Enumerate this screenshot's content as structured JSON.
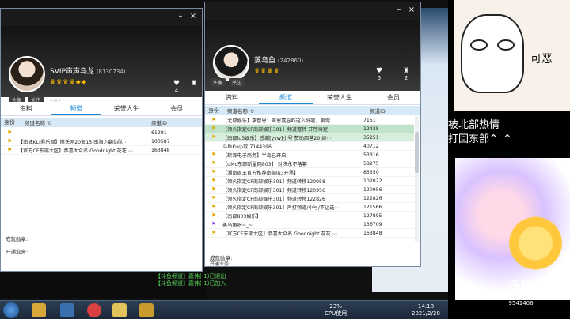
{
  "left_window": {
    "user": {
      "name": "SVIP声声乌龙",
      "id": "(8130734)",
      "sub": "vwy"
    },
    "mini_tabs": [
      "头像",
      "关注"
    ],
    "stats": [
      {
        "icon": "heart-icon",
        "value": "4"
      },
      {
        "icon": "trophy-icon",
        "value": ""
      }
    ],
    "tabs": [
      "资料",
      "频道",
      "荣誉人生",
      "会员"
    ],
    "headers": {
      "pos": "身份",
      "name": "频道名称",
      "id": "频道ID"
    },
    "rows": [
      {
        "name": "",
        "id": "61291"
      },
      {
        "name": "【南城KLI俱乐部】崩氏网20安15  南海之翻伪队⋯",
        "id": "100587"
      },
      {
        "name": "【官方CF东部大区】恭喜大众名 Goodnight 花花 ⋯",
        "id": "163848"
      }
    ],
    "footer": [
      "成就勋章:",
      "开通业务:"
    ]
  },
  "right_window": {
    "user": {
      "name": "蒸乌鱼",
      "id": "(242860)"
    },
    "mini_tabs": [
      "头像",
      "关注"
    ],
    "stats": [
      {
        "icon": "heart-icon",
        "value": "5"
      },
      {
        "icon": "trophy-icon",
        "value": "2"
      }
    ],
    "tabs": [
      "资料",
      "频道",
      "荣誉人生",
      "会员"
    ],
    "headers": {
      "pos": "身份",
      "name": "频道名称",
      "id": "频道ID"
    },
    "rows": [
      {
        "name": "【北部娱乐】李智恩：声恩嘉@咋这么好呢，爱你",
        "id": "7151"
      },
      {
        "name": "【领久指定CF南部娱乐301】频道整转 开厅待定",
        "id": "12438"
      },
      {
        "name": "【南部lu3娱乐】感谢[yyw]小号 赞助西营20 妹⋯",
        "id": "35251"
      },
      {
        "name": "斗鱼Ku小软 7144396",
        "id": "40712"
      },
      {
        "name": "【斩泽电子商务】半岛已开启",
        "id": "53316"
      },
      {
        "name": "【uMc东部断量网803】 对决永不落幕",
        "id": "58275"
      },
      {
        "name": "【湖南周王官方推荐南部lu3开黑】",
        "id": "83350"
      },
      {
        "name": "【领久指定CF南部娱乐301】频道转移120958",
        "id": "102022"
      },
      {
        "name": "【领久指定CF南部娱乐301】频道转移120956",
        "id": "120956"
      },
      {
        "name": "【领久指定CF南部娱乐301】频道转移122826",
        "id": "122826"
      },
      {
        "name": "【领久指定CF南部娱乐301】声打频道/小号/不让选⋯",
        "id": "121566"
      },
      {
        "name": "【南部803娱乐】",
        "id": "127895"
      },
      {
        "name": "蒸乌鱼呀~_~",
        "id": "136709"
      },
      {
        "name": "【官方CF东部大区】恭喜大众名 Goodnight 花花 ⋯",
        "id": "163848"
      }
    ],
    "footer": [
      "成就勋章:",
      "开通业务:"
    ]
  },
  "chat_log": [
    "【斗鱼频道】嘉伟(-1)已退出",
    "【斗鱼频道】嘉伟(-1)已加入"
  ],
  "overlay": {
    "meme_text": "可恶",
    "caption": [
      "被北部热情",
      "打回东部^_^"
    ],
    "logo_text": "斗鱼",
    "room_label": "房间号",
    "room_number": "9541406"
  },
  "taskbar": {
    "cpu_percent": "23%",
    "cpu_label": "CPU使用",
    "time": "14:18",
    "date": "2021/2/28"
  },
  "colors": {
    "accent": "#1a8ad8",
    "highlight_row": "#bfe3c8",
    "chat_green": "#59d359"
  }
}
